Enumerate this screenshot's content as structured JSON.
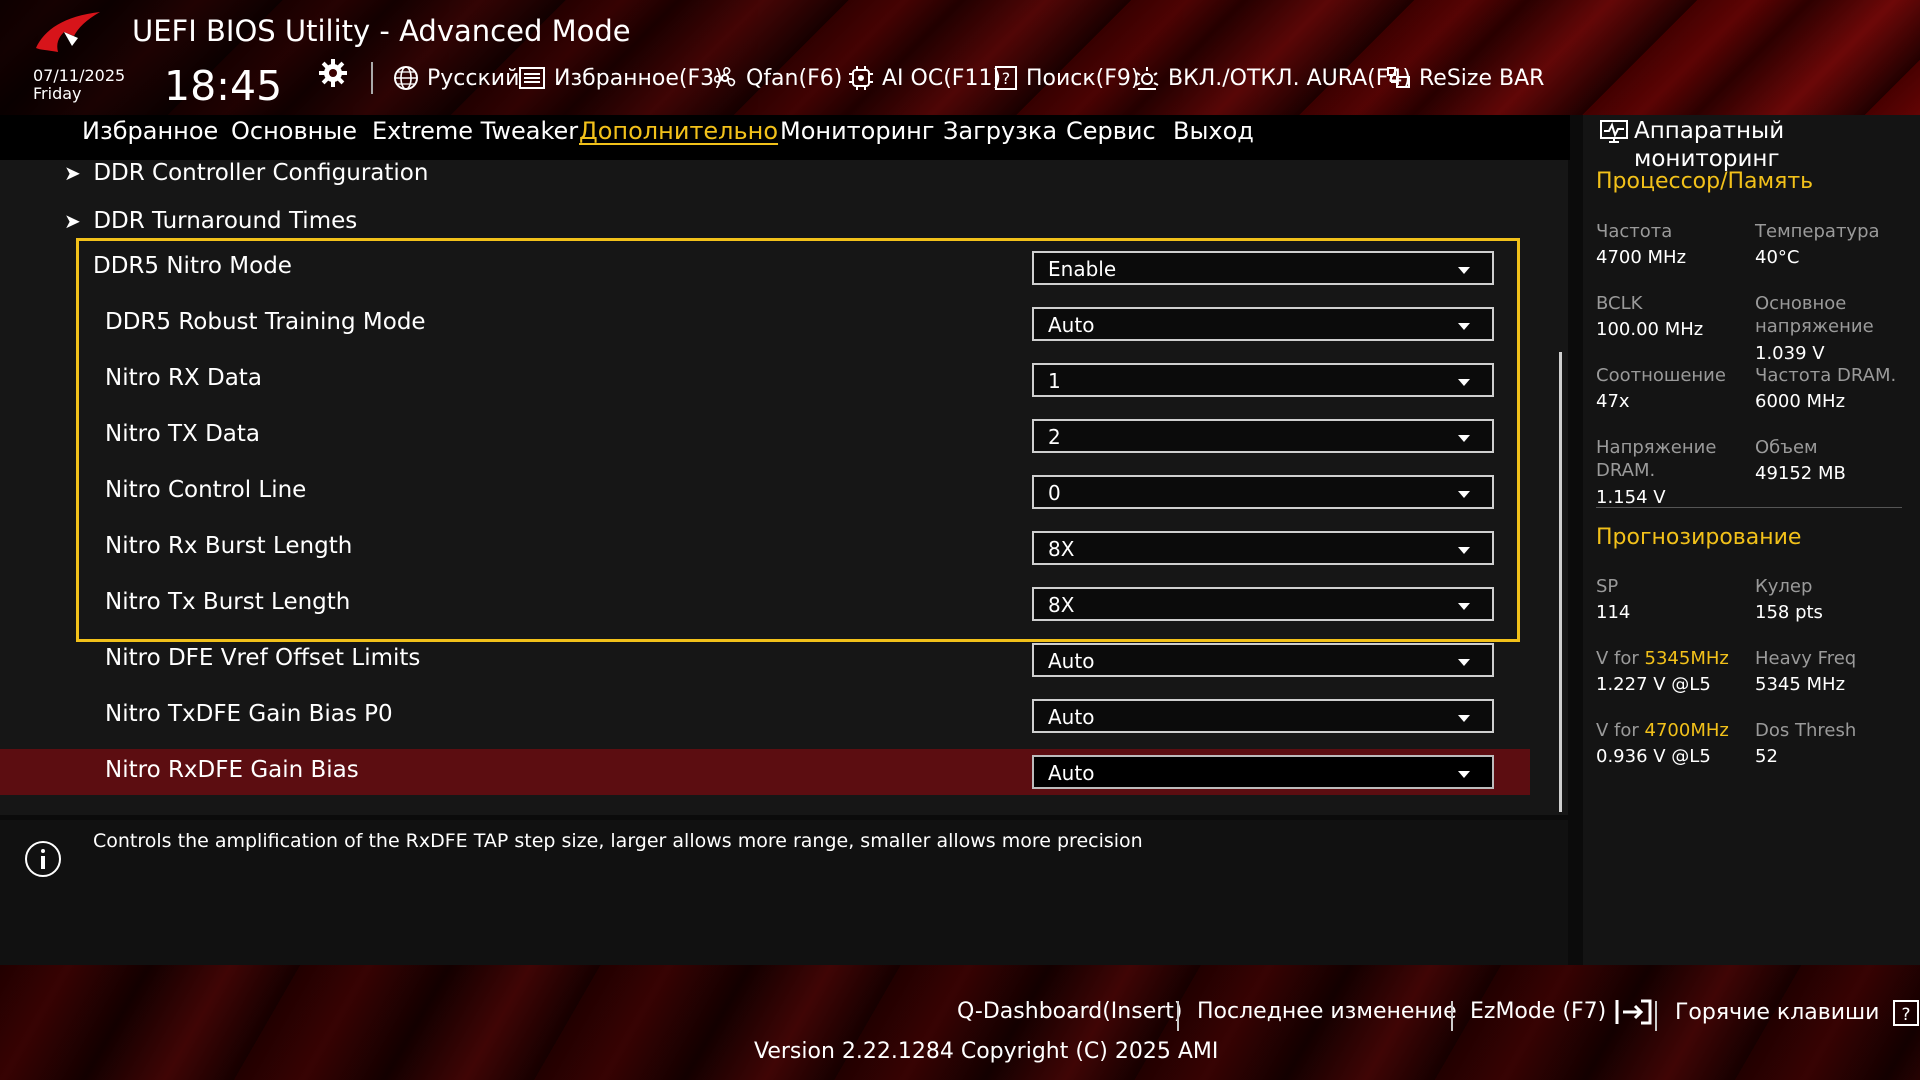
{
  "header": {
    "title": "UEFI BIOS Utility - Advanced Mode",
    "date": "07/11/2025",
    "weekday": "Friday",
    "time": "18:45",
    "toolbar": [
      {
        "label": "Русский",
        "icon": "globe-icon"
      },
      {
        "label": "Избранное(F3)",
        "icon": "favorites-icon"
      },
      {
        "label": "Qfan(F6)",
        "icon": "fan-icon"
      },
      {
        "label": "AI OC(F11)",
        "icon": "ai-chip-icon"
      },
      {
        "label": "Поиск(F9)",
        "icon": "search-help-icon"
      },
      {
        "label": "ВКЛ./ОТКЛ. AURA(F4)",
        "icon": "aura-icon"
      },
      {
        "label": "ReSize BAR",
        "icon": "resize-bar-icon"
      }
    ]
  },
  "nav": {
    "tabs": [
      {
        "label": "Избранное"
      },
      {
        "label": "Основные"
      },
      {
        "label": "Extreme Tweaker"
      },
      {
        "label": "Дополнительно"
      },
      {
        "label": "Мониторинг"
      },
      {
        "label": "Загрузка"
      },
      {
        "label": "Сервис"
      },
      {
        "label": "Выход"
      }
    ],
    "active": "Дополнительно"
  },
  "content": {
    "submenus": [
      {
        "label": "DDR Controller Configuration"
      },
      {
        "label": "DDR Turnaround Times"
      }
    ],
    "settings": [
      {
        "label": "DDR5 Nitro Mode",
        "value": "Enable"
      },
      {
        "label": "DDR5 Robust Training Mode",
        "value": "Auto"
      },
      {
        "label": "Nitro RX Data",
        "value": "1"
      },
      {
        "label": "Nitro TX Data",
        "value": "2"
      },
      {
        "label": "Nitro Control Line",
        "value": "0"
      },
      {
        "label": "Nitro Rx Burst Length",
        "value": "8X"
      },
      {
        "label": "Nitro Tx Burst Length",
        "value": "8X"
      },
      {
        "label": "Nitro DFE Vref Offset Limits",
        "value": "Auto"
      },
      {
        "label": "Nitro TxDFE Gain Bias P0",
        "value": "Auto"
      },
      {
        "label": "Nitro RxDFE Gain Bias",
        "value": "Auto"
      }
    ],
    "selected_setting": "Nitro RxDFE Gain Bias"
  },
  "description": {
    "text": "Controls the amplification of the RxDFE TAP step size, larger allows more range, smaller allows more precision"
  },
  "hw_monitor": {
    "title_line1": "Аппаратный",
    "title_line2": "мониторинг",
    "cpu_mem": {
      "section": "Процессор/Память",
      "items": [
        {
          "label": "Частота",
          "value": "4700 MHz"
        },
        {
          "label": "Температура",
          "value": "40°C"
        },
        {
          "label": "BCLK",
          "value": "100.00 MHz"
        },
        {
          "label": "Основное напряжение",
          "value": "1.039 V"
        },
        {
          "label": "Соотношение",
          "value": "47x"
        },
        {
          "label": "Частота DRAM.",
          "value": "6000 MHz"
        },
        {
          "label": "Напряжение DRAM.",
          "value": "1.154 V"
        },
        {
          "label": "Объем",
          "value": "49152 MB"
        }
      ]
    },
    "prediction": {
      "section": "Прогнозирование",
      "sp_label": "SP",
      "sp_value": "114",
      "cooler_label": "Кулер",
      "cooler_value": "158 pts",
      "v1_prefix": "V for ",
      "v1_freq": "5345MHz",
      "v1_value": "1.227 V @L5",
      "heavy_label": "Heavy Freq",
      "heavy_value": "5345 MHz",
      "v2_prefix": "V for ",
      "v2_freq": "4700MHz",
      "v2_value": "0.936 V @L5",
      "dos_label": "Dos Thresh",
      "dos_value": "52"
    }
  },
  "footer": {
    "qdashboard": "Q-Dashboard(Insert)",
    "last_change": "Последнее изменение",
    "ezmode": "EzMode (F7)",
    "hotkeys": "Горячие клавиши",
    "version": "Version 2.22.1284 Copyright (C) 2025 AMI"
  },
  "colors": {
    "accent": "#f2c11a",
    "selected_row": "#5c0d11",
    "header_red": "#7c0505"
  }
}
